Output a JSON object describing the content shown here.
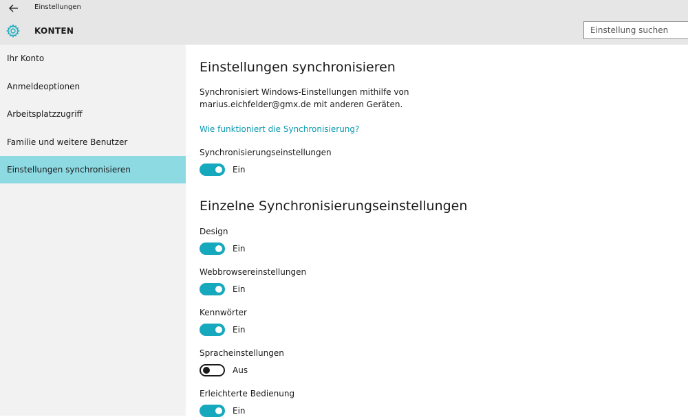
{
  "window": {
    "title": "Einstellungen"
  },
  "header": {
    "section_title": "KONTEN",
    "icon": "gear-icon"
  },
  "search": {
    "placeholder": "Einstellung suchen",
    "value": ""
  },
  "sidebar": {
    "items": [
      {
        "label": "Ihr Konto",
        "active": false
      },
      {
        "label": "Anmeldeoptionen",
        "active": false
      },
      {
        "label": "Arbeitsplatzzugriff",
        "active": false
      },
      {
        "label": "Familie und weitere Benutzer",
        "active": false
      },
      {
        "label": "Einstellungen synchronisieren",
        "active": true
      }
    ]
  },
  "main": {
    "heading": "Einstellungen synchronisieren",
    "description_line1": "Synchronisiert Windows-Einstellungen mithilfe von",
    "description_line2": "marius.eichfelder@gmx.de mit anderen Geräten.",
    "help_link": "Wie funktioniert die Synchronisierung?",
    "master": {
      "label": "Synchronisierungseinstellungen",
      "state": "Ein",
      "on": true
    },
    "individual_heading": "Einzelne Synchronisierungseinstellungen",
    "settings": [
      {
        "label": "Design",
        "state": "Ein",
        "on": true
      },
      {
        "label": "Webbrowsereinstellungen",
        "state": "Ein",
        "on": true
      },
      {
        "label": "Kennwörter",
        "state": "Ein",
        "on": true
      },
      {
        "label": "Spracheinstellungen",
        "state": "Aus",
        "on": false
      },
      {
        "label": "Erleichterte Bedienung",
        "state": "Ein",
        "on": true
      }
    ]
  },
  "colors": {
    "accent": "#16a8bd",
    "link": "#0b9ab0",
    "nav_active": "#8ddae3",
    "titlebar": "#e6e6e6",
    "sidebar": "#f2f2f2"
  }
}
